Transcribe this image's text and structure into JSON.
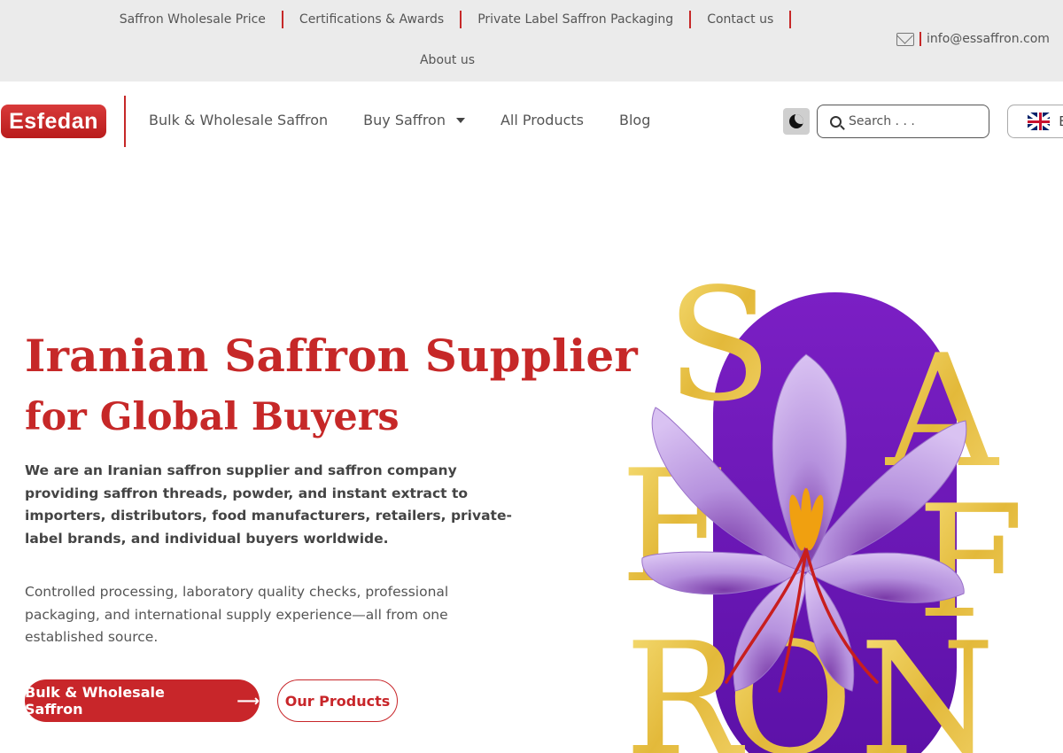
{
  "topbar": {
    "links": [
      "Saffron Wholesale Price",
      "Certifications & Awards",
      "Private Label Saffron Packaging",
      "Contact us",
      "About us"
    ],
    "email": "info@essaffron.com"
  },
  "nav": {
    "logo_text": "Esfedan",
    "menu": [
      "Bulk & Wholesale Saffron",
      "Buy Saffron",
      "All Products",
      "Blog"
    ],
    "search_placeholder": "Search . . .",
    "language": "EN"
  },
  "hero": {
    "title_line1": "Iranian Saffron Supplier",
    "title_line2": "for Global Buyers",
    "intro": "We are an Iranian saffron supplier and saffron company providing saffron threads, powder, and instant extract to importers, distributors, food manufacturers, retailers, private-label brands, and individual buyers worldwide.",
    "detail": "Controlled processing, laboratory quality checks, professional packaging, and international supply experience—all from one established source.",
    "primary_button": "Bulk & Wholesale Saffron",
    "secondary_button": "Our Products",
    "art_letters": [
      "S",
      "A",
      "F",
      "F",
      "R",
      "O",
      "N"
    ]
  },
  "colors": {
    "brand_red": "#c8262a",
    "gold": "#e8c34a",
    "purple": "#6a14b8",
    "petal": "#b893e0"
  },
  "icons": {
    "mail": "envelope-icon",
    "dark_mode": "moon-icon",
    "search": "search-icon",
    "caret": "chevron-down-icon",
    "flag": "uk-flag-icon",
    "arrow": "arrow-right-icon"
  }
}
